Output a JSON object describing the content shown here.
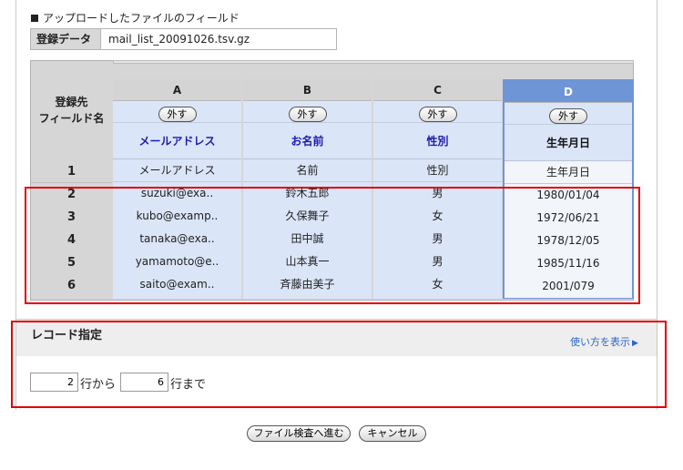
{
  "upload": {
    "section_title": "アップロードしたファイルのフィールド",
    "registered_label": "登録データ",
    "registered_value": "mail_list_20091026.tsv.gz"
  },
  "mapping_table": {
    "row_header_line1": "登録先",
    "row_header_line2": "フィールド名",
    "columns": [
      {
        "letter": "A",
        "remove_label": "外す",
        "field_name": "メールアドレス",
        "cells": [
          "メールアドレス",
          "suzuki@exa..",
          "kubo@examp..",
          "tanaka@exa..",
          "yamamoto@e..",
          "saito@exam.."
        ]
      },
      {
        "letter": "B",
        "remove_label": "外す",
        "field_name": "お名前",
        "cells": [
          "名前",
          "鈴木五郎",
          "久保舞子",
          "田中誠",
          "山本真一",
          "斉藤由美子"
        ]
      },
      {
        "letter": "C",
        "remove_label": "外す",
        "field_name": "性別",
        "cells": [
          "性別",
          "男",
          "女",
          "男",
          "男",
          "女"
        ]
      },
      {
        "letter": "D",
        "remove_label": "外す",
        "field_name": "生年月日",
        "cells": [
          "生年月日",
          "1980/01/04",
          "1972/06/21",
          "1978/12/05",
          "1985/11/16",
          "2001/079"
        ],
        "selected": true
      }
    ],
    "row_numbers": [
      "1",
      "2",
      "3",
      "4",
      "5",
      "6"
    ]
  },
  "record_spec": {
    "title": "レコード指定",
    "help_link": "使い方を表示",
    "help_arrow": "▶",
    "from_value": "2",
    "from_label": "行から",
    "to_value": "6",
    "to_label": "行まで"
  },
  "actions": {
    "proceed_label": "ファイル検査へ進む",
    "cancel_label": "キャンセル"
  },
  "colors": {
    "selected_column": "#6e95d6",
    "column_bg": "#dbe5f8",
    "field_name_text": "#1b1bb0",
    "highlight_red": "#e00000",
    "link_blue": "#2d64c8"
  }
}
